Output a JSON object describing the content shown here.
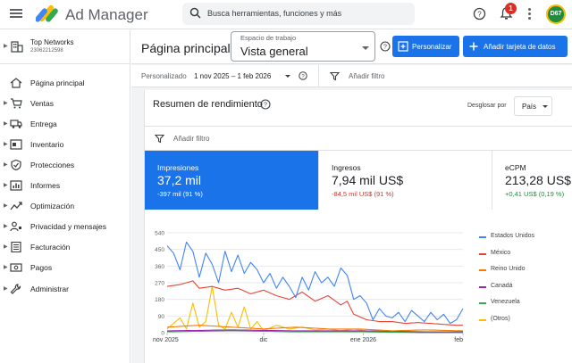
{
  "app": {
    "title": "Ad Manager"
  },
  "search": {
    "placeholder": "Busca herramientas, funciones y más"
  },
  "notifications": {
    "count": "1"
  },
  "user": {
    "initials": "D67"
  },
  "network": {
    "name": "Top Networks",
    "id": "23062212598"
  },
  "sidebar": {
    "items": [
      {
        "label": "Página principal",
        "icon": "home-icon"
      },
      {
        "label": "Ventas",
        "icon": "cart-icon"
      },
      {
        "label": "Entrega",
        "icon": "truck-icon"
      },
      {
        "label": "Inventario",
        "icon": "inventory-icon"
      },
      {
        "label": "Protecciones",
        "icon": "shield-icon"
      },
      {
        "label": "Informes",
        "icon": "bar-chart-icon"
      },
      {
        "label": "Optimización",
        "icon": "trend-icon"
      },
      {
        "label": "Privacidad y mensajes",
        "icon": "privacy-icon"
      },
      {
        "label": "Facturación",
        "icon": "billing-icon"
      },
      {
        "label": "Pagos",
        "icon": "payments-icon"
      },
      {
        "label": "Administrar",
        "icon": "wrench-icon"
      }
    ]
  },
  "header": {
    "title": "Página principal",
    "workspace_label": "Espacio de trabajo",
    "workspace_value": "Vista general",
    "personalize_label": "Personalizar",
    "add_card_label": "Añadir tarjeta de datos"
  },
  "filterbar": {
    "date_prefix": "Personalizado",
    "date_range": "1 nov 2025 – 1 feb 2026",
    "filter_label": "Añadir filtro"
  },
  "card": {
    "title": "Resumen de rendimiento",
    "breakdown_label": "Desglosar por",
    "breakdown_value": "País",
    "filter_label": "Añadir filtro"
  },
  "metrics": [
    {
      "name": "Impresiones",
      "value": "37,2 mil",
      "delta": "-397 mil (91 %)"
    },
    {
      "name": "Ingresos",
      "value": "7,94 mil US$",
      "delta": "-84,5 mil US$ (91 %)"
    },
    {
      "name": "eCPM",
      "value": "213,28 US$",
      "delta": "+0,41 US$ (0,19 %)"
    }
  ],
  "chart_data": {
    "type": "line",
    "x_ticks": [
      "nov 2025",
      "dic",
      "ene 2026",
      "feb"
    ],
    "yticks": [
      0,
      90,
      180,
      270,
      360,
      450,
      540
    ],
    "ylim": [
      0,
      540
    ],
    "n_points": 93,
    "grid": true,
    "legend": "right",
    "series": [
      {
        "name": "Estados Unidos",
        "color": "#4285f4",
        "anchors": [
          [
            0,
            470
          ],
          [
            2,
            430
          ],
          [
            4,
            340
          ],
          [
            6,
            490
          ],
          [
            8,
            440
          ],
          [
            10,
            300
          ],
          [
            12,
            430
          ],
          [
            14,
            370
          ],
          [
            16,
            270
          ],
          [
            18,
            440
          ],
          [
            20,
            330
          ],
          [
            22,
            420
          ],
          [
            24,
            320
          ],
          [
            26,
            380
          ],
          [
            28,
            340
          ],
          [
            30,
            270
          ],
          [
            32,
            320
          ],
          [
            34,
            240
          ],
          [
            36,
            300
          ],
          [
            38,
            250
          ],
          [
            40,
            190
          ],
          [
            42,
            300
          ],
          [
            44,
            230
          ],
          [
            46,
            330
          ],
          [
            48,
            270
          ],
          [
            50,
            300
          ],
          [
            52,
            250
          ],
          [
            54,
            350
          ],
          [
            56,
            310
          ],
          [
            58,
            180
          ],
          [
            60,
            200
          ],
          [
            62,
            160
          ],
          [
            64,
            70
          ],
          [
            66,
            130
          ],
          [
            68,
            90
          ],
          [
            70,
            80
          ],
          [
            72,
            110
          ],
          [
            74,
            60
          ],
          [
            76,
            120
          ],
          [
            78,
            90
          ],
          [
            80,
            60
          ],
          [
            82,
            110
          ],
          [
            84,
            70
          ],
          [
            86,
            100
          ],
          [
            88,
            50
          ],
          [
            90,
            70
          ],
          [
            92,
            130
          ]
        ]
      },
      {
        "name": "México",
        "color": "#ea4335",
        "anchors": [
          [
            0,
            250
          ],
          [
            4,
            260
          ],
          [
            8,
            280
          ],
          [
            10,
            240
          ],
          [
            14,
            250
          ],
          [
            18,
            230
          ],
          [
            22,
            240
          ],
          [
            26,
            210
          ],
          [
            30,
            230
          ],
          [
            34,
            200
          ],
          [
            38,
            180
          ],
          [
            42,
            220
          ],
          [
            46,
            170
          ],
          [
            50,
            200
          ],
          [
            54,
            150
          ],
          [
            56,
            170
          ],
          [
            58,
            100
          ],
          [
            62,
            70
          ],
          [
            66,
            60
          ],
          [
            70,
            60
          ],
          [
            74,
            50
          ],
          [
            78,
            55
          ],
          [
            82,
            50
          ],
          [
            86,
            45
          ],
          [
            90,
            40
          ],
          [
            92,
            40
          ]
        ]
      },
      {
        "name": "Reino Unido",
        "color": "#f57c00",
        "anchors": [
          [
            0,
            30
          ],
          [
            10,
            40
          ],
          [
            20,
            30
          ],
          [
            30,
            20
          ],
          [
            40,
            30
          ],
          [
            50,
            20
          ],
          [
            60,
            20
          ],
          [
            70,
            10
          ],
          [
            80,
            15
          ],
          [
            92,
            10
          ]
        ]
      },
      {
        "name": "Canadá",
        "color": "#9c27b0",
        "anchors": [
          [
            0,
            10
          ],
          [
            20,
            15
          ],
          [
            40,
            10
          ],
          [
            60,
            10
          ],
          [
            80,
            5
          ],
          [
            92,
            5
          ]
        ]
      },
      {
        "name": "Venezuela",
        "color": "#34a853",
        "anchors": [
          [
            0,
            5
          ],
          [
            20,
            10
          ],
          [
            40,
            5
          ],
          [
            60,
            5
          ],
          [
            80,
            0
          ],
          [
            92,
            0
          ]
        ]
      },
      {
        "name": "(Otros)",
        "color": "#fbbc04",
        "anchors": [
          [
            0,
            20
          ],
          [
            4,
            80
          ],
          [
            6,
            20
          ],
          [
            8,
            160
          ],
          [
            10,
            30
          ],
          [
            12,
            60
          ],
          [
            14,
            250
          ],
          [
            16,
            40
          ],
          [
            18,
            20
          ],
          [
            20,
            110
          ],
          [
            22,
            30
          ],
          [
            24,
            140
          ],
          [
            26,
            20
          ],
          [
            28,
            60
          ],
          [
            30,
            10
          ],
          [
            34,
            40
          ],
          [
            38,
            20
          ],
          [
            42,
            30
          ],
          [
            46,
            15
          ],
          [
            50,
            20
          ],
          [
            54,
            10
          ],
          [
            58,
            20
          ],
          [
            62,
            10
          ],
          [
            70,
            5
          ],
          [
            80,
            5
          ],
          [
            92,
            0
          ]
        ]
      }
    ]
  }
}
